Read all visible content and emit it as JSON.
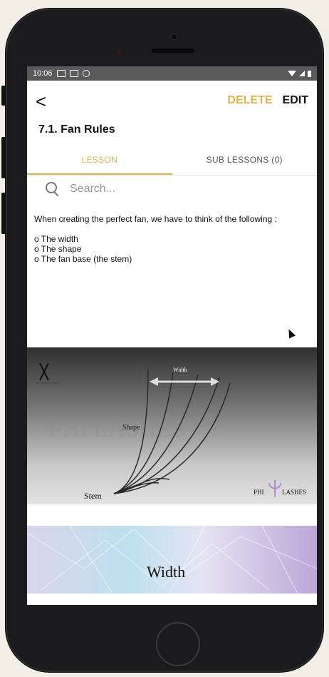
{
  "status_bar": {
    "time": "10:06"
  },
  "appbar": {
    "back_label": "<",
    "delete_label": "DELETE",
    "edit_label": "EDIT"
  },
  "lesson": {
    "title": "7.1. Fan Rules"
  },
  "tabs": [
    {
      "label": "LESSON",
      "active": true
    },
    {
      "label": "SUB LESSONS (0)",
      "active": false
    }
  ],
  "search": {
    "placeholder": "Search..."
  },
  "body": {
    "intro": "When creating the perfect fan, we have to think of the following :",
    "items": [
      "The width",
      "The shape",
      "The fan base (the stem)"
    ]
  },
  "fan_image": {
    "labels": {
      "width": "Width",
      "shape": "Shape",
      "stem": "Stem"
    },
    "watermark": "PHI LASHES",
    "brand_left": "PHI",
    "brand_right": "LASHES"
  },
  "width_image": {
    "title": "Width"
  },
  "colors": {
    "accent": "#e0b24d",
    "status_bar": "#5a5a5a"
  }
}
